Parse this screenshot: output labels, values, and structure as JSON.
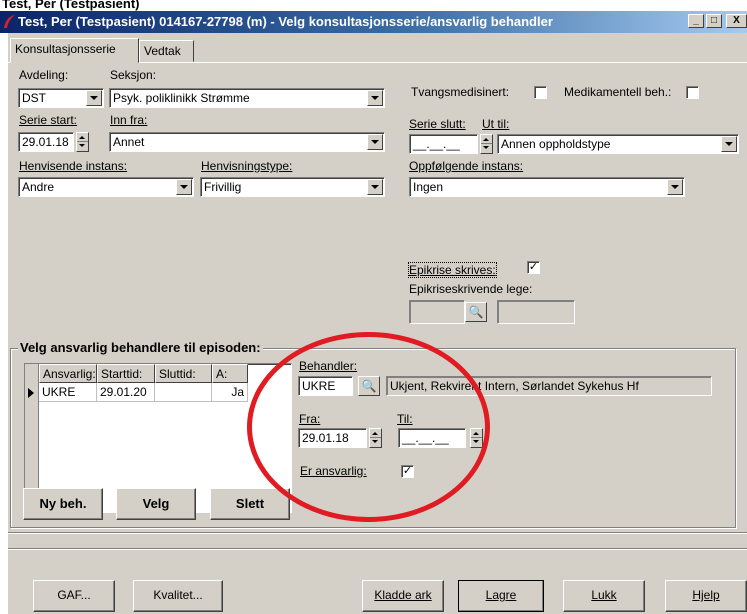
{
  "top_crop_text": "Test, Per (Testpasient)",
  "titlebar": {
    "title": "Test, Per (Testpasient) 014167-27798 (m) - Velg konsultasjonsserie/ansvarlig behandler",
    "minimize": "_",
    "maximize": "□",
    "close": "X"
  },
  "tabs": [
    "Konsultasjonsserie",
    "Vedtak"
  ],
  "form": {
    "avdeling_label": "Avdeling:",
    "avdeling_value": "DST",
    "seksjon_label": "Seksjon:",
    "seksjon_value": "Psyk. poliklinikk Strømme",
    "tvangsmedisinert_label": "Tvangsmedisinert:",
    "tvangsmedisinert_checked": false,
    "medikamentell_label": "Medikamentell beh.:",
    "medikamentell_checked": false,
    "serie_start_label": "Serie start:",
    "serie_start_value": "29.01.18",
    "inn_fra_label": "Inn fra:",
    "inn_fra_value": "Annet",
    "serie_slutt_label": "Serie slutt:",
    "serie_slutt_value": "__.__.__",
    "ut_til_label": "Ut til:",
    "ut_til_value": "Annen oppholdstype",
    "henvisende_label": "Henvisende instans:",
    "henvisende_value": "Andre",
    "henvisningstype_label": "Henvisningstype:",
    "henvisningstype_value": "Frivillig",
    "oppfolgende_label": "Oppfølgende instans:",
    "oppfolgende_value": "Ingen",
    "epikrise_label": "Epikrise skrives:",
    "epikrise_checked": true,
    "epikriselege_label": "Epikriseskrivende lege:",
    "epikriselege_value": ""
  },
  "ansvarlig": {
    "group_title": "Velg ansvarlig behandlere til episoden:",
    "columns": [
      "Ansvarlig:",
      "Starttid:",
      "Sluttid:",
      "A:"
    ],
    "rows": [
      {
        "ansvarlig": "UKRE",
        "starttid": "29.01.20",
        "sluttid": "",
        "a": "Ja"
      }
    ],
    "behandler_label": "Behandler:",
    "behandler_code": "UKRE",
    "behandler_name": "Ukjent, Rekvirent Intern, Sørlandet Sykehus Hf",
    "fra_label": "Fra:",
    "fra_value": "29.01.18",
    "til_label": "Til:",
    "til_value": "__.__.__",
    "er_ansvarlig_label": "Er ansvarlig:",
    "er_ansvarlig_checked": true,
    "ny_beh_button": "Ny beh.",
    "velg_button": "Velg",
    "slett_button": "Slett"
  },
  "footer_buttons": {
    "gaf": "GAF...",
    "kvalitet": "Kvalitet...",
    "kladde_ark": "Kladde ark",
    "lagre": "Lagre",
    "lukk": "Lukk",
    "hjelp": "Hjelp"
  },
  "colors": {
    "window_face": "#d4d0c8",
    "title_active": "#0a246a",
    "annotation_circle": "#e11b22"
  },
  "icons": {
    "app_icon": "app-red-swoosh-icon",
    "search": "binoculars-icon"
  }
}
